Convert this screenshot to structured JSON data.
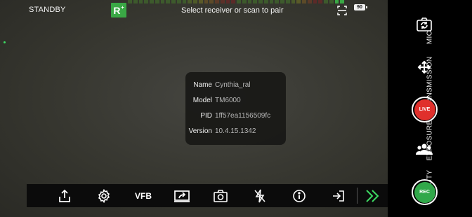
{
  "status": {
    "state": "STANDBY"
  },
  "pairing": {
    "logo_text": "R",
    "message": "Select receiver or scan to pair",
    "battery": "90"
  },
  "meter_colors": [
    "#3d5a2c",
    "#3d5a2c",
    "#3d5a2c",
    "#3d5a2c",
    "#3d5a2c",
    "#3d5a2c",
    "#3d5a2c",
    "#3d5a2c",
    "#3d5a2c",
    "#3d5a2c",
    "#3d5a2c",
    "#4a5a2a",
    "#4e5a28",
    "#5a5a28",
    "#5c4a28",
    "#5c4a28",
    "#5c3a28",
    "#5c3028",
    "#5c2a28",
    "#5c2a28",
    "#3d5a2c",
    "#3d5a2c",
    "#3d5a2c",
    "#3d5a2c",
    "#3d5a2c",
    "#3d5a2c",
    "#3d5a2c",
    "#3d5a2c",
    "#3d5a2c",
    "#3d5a2c",
    "#4a5a2a",
    "#5a5a28",
    "#5c4a28",
    "#5c3a28",
    "#5c2a28",
    "#5c2a28",
    "#3d5a2c",
    "#3d5a2c",
    "#3aa845",
    "#3aa845"
  ],
  "device_info": [
    {
      "key": "Name",
      "value": "Cynthia_ral"
    },
    {
      "key": "Model",
      "value": "TM6000"
    },
    {
      "key": "PID",
      "value": "1ff57ea1156509fc"
    },
    {
      "key": "Version",
      "value": "10.4.15.1342"
    }
  ],
  "toolbar": {
    "vfb_label": "VFB",
    "items": [
      "share",
      "settings",
      "VFB",
      "screen-share",
      "camera",
      "flash-off",
      "info",
      "exit"
    ]
  },
  "right_panel": {
    "tabs": [
      "MIC",
      "TRANSMISSION",
      "EXPOSURE",
      "BEAUTY"
    ],
    "live_label": "LIVE",
    "rec_label": "REC",
    "icons": [
      "camera-rotate-icon",
      "arrows-move-icon",
      "people-icon"
    ]
  },
  "colors": {
    "accent_green": "#3aa845",
    "live_red": "#e0302c",
    "rec_green": "#31a84a"
  }
}
